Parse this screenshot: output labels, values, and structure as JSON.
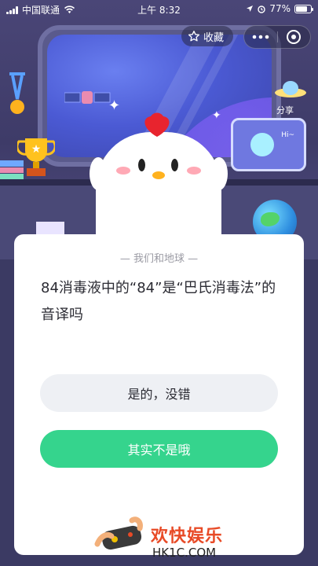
{
  "status_bar": {
    "carrier": "中国联通",
    "time": "上午 8:32",
    "battery_percent": "77%",
    "battery_level": 0.77
  },
  "header": {
    "favorite_label": "收藏",
    "share_label": "分享"
  },
  "scene": {
    "tv_text": "Hi~"
  },
  "quiz": {
    "category": "— 我们和地球 —",
    "question": "84消毒液中的“84”是“巴氏消毒法”的音译吗",
    "options": [
      {
        "label": "是的，没错"
      },
      {
        "label": "其实不是哦"
      }
    ]
  },
  "watermark": {
    "title": "欢快娱乐",
    "url": "HK1C.COM"
  },
  "colors": {
    "accent_green": "#35d48d",
    "option_gray": "#eef0f4",
    "background": "#3b3a63"
  }
}
